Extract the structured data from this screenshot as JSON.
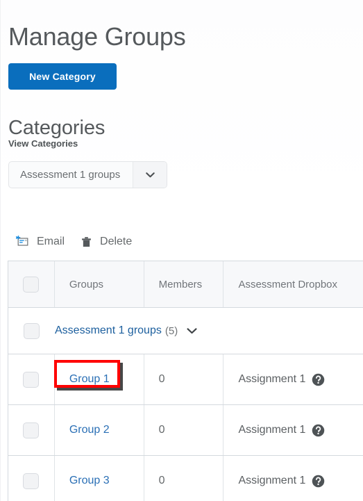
{
  "page": {
    "title": "Manage Groups"
  },
  "actions": {
    "new_category": "New Category"
  },
  "categories_section": {
    "heading": "Categories",
    "view_label": "View Categories",
    "select": {
      "value": "Assessment 1 groups",
      "arrow_icon": "chevron-down-icon"
    }
  },
  "toolbar": {
    "items": [
      {
        "label": "Email",
        "icon": "email-icon"
      },
      {
        "label": "Delete",
        "icon": "trash-icon"
      }
    ]
  },
  "table": {
    "columns": [
      "",
      "Groups",
      "Members",
      "Assessment Dropbox"
    ],
    "category_row": {
      "name": "Assessment 1 groups",
      "count": "(5)",
      "toggle_icon": "chevron-down-icon"
    },
    "rows": [
      {
        "group": "Group 1",
        "members": "0",
        "dropbox": "Assignment 1",
        "help_icon": "help-circle-icon",
        "highlighted": true
      },
      {
        "group": "Group 2",
        "members": "0",
        "dropbox": "Assignment 1",
        "help_icon": "help-circle-icon",
        "highlighted": false
      },
      {
        "group": "Group 3",
        "members": "0",
        "dropbox": "Assignment 1",
        "help_icon": "help-circle-icon",
        "highlighted": false
      }
    ]
  },
  "colors": {
    "primary_button": "#0a6ebd",
    "link": "#2a6fb5",
    "highlight": "#ff0000",
    "header_bg": "#f7f8fa",
    "border": "#d4d9de"
  }
}
